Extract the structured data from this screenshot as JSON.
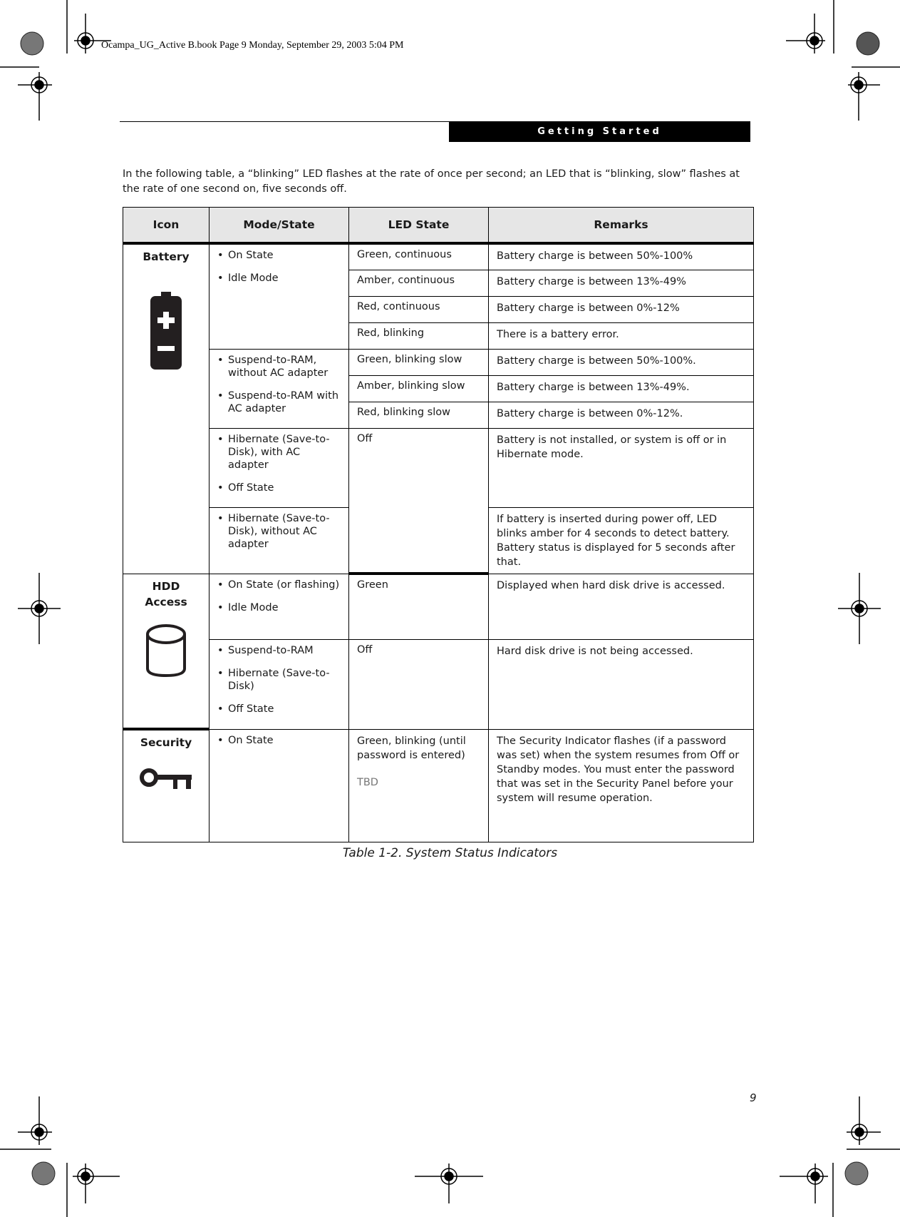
{
  "book_header": "Ocampa_UG_Active B.book  Page 9  Monday, September 29, 2003  5:04 PM",
  "section_title": "Getting Started",
  "intro": "In the following table, a “blinking” LED flashes at the rate of once per second; an LED that is “blinking, slow” flashes at the rate of one second on, five seconds off.",
  "table": {
    "headers": [
      "Icon",
      "Mode/State",
      "LED State",
      "Remarks"
    ],
    "groups": {
      "battery": {
        "label": "Battery",
        "icon": "battery-icon",
        "modes": [
          [
            "On State",
            "Idle Mode"
          ],
          [
            "Suspend-to-RAM, without AC adapter",
            "Suspend-to-RAM with AC adapter"
          ],
          [
            "Hibernate (Save-to-Disk), with AC adapter",
            "Off State"
          ],
          [
            "Hibernate (Save-to-Disk), without AC adapter"
          ]
        ],
        "rows": [
          {
            "led": "Green, continuous",
            "remark": "Battery charge is between 50%-100%"
          },
          {
            "led": "Amber, continuous",
            "remark": "Battery charge is between 13%-49%"
          },
          {
            "led": "Red, continuous",
            "remark": "Battery charge is between 0%-12%"
          },
          {
            "led": "Red, blinking",
            "remark": "There is a battery error."
          },
          {
            "led": "Green, blinking slow",
            "remark": "Battery charge is between 50%-100%."
          },
          {
            "led": "Amber, blinking slow",
            "remark": "Battery charge is between 13%-49%."
          },
          {
            "led": "Red, blinking slow",
            "remark": "Battery charge is between 0%-12%."
          },
          {
            "led": "Off",
            "remark": "Battery is not installed, or system is off or in Hibernate mode."
          },
          {
            "led": "",
            "remark": "If battery is inserted during power off, LED blinks amber for 4 seconds to detect battery. Battery status is displayed for 5 seconds after that."
          }
        ]
      },
      "hdd": {
        "label": "HDD Access",
        "icon": "hard-disk-icon",
        "rows": [
          {
            "modes": [
              "On State (or flashing)",
              "Idle Mode"
            ],
            "led": "Green",
            "remark": "Displayed when hard disk drive is accessed."
          },
          {
            "modes": [
              "Suspend-to-RAM",
              "Hibernate (Save-to-Disk)",
              "Off State"
            ],
            "led": "Off",
            "remark": "Hard disk drive is not being accessed."
          }
        ]
      },
      "security": {
        "label": "Security",
        "icon": "key-icon",
        "rows": [
          {
            "modes": [
              "On State"
            ],
            "led": "Green, blinking (until password is entered)",
            "led_note": "TBD",
            "remark": "The Security Indicator flashes (if a password was set) when the system resumes from Off or Standby modes. You must enter the password that was set in the Security Panel before your system will resume operation."
          }
        ]
      }
    }
  },
  "caption": "Table 1-2. System Status Indicators",
  "page_number": "9"
}
